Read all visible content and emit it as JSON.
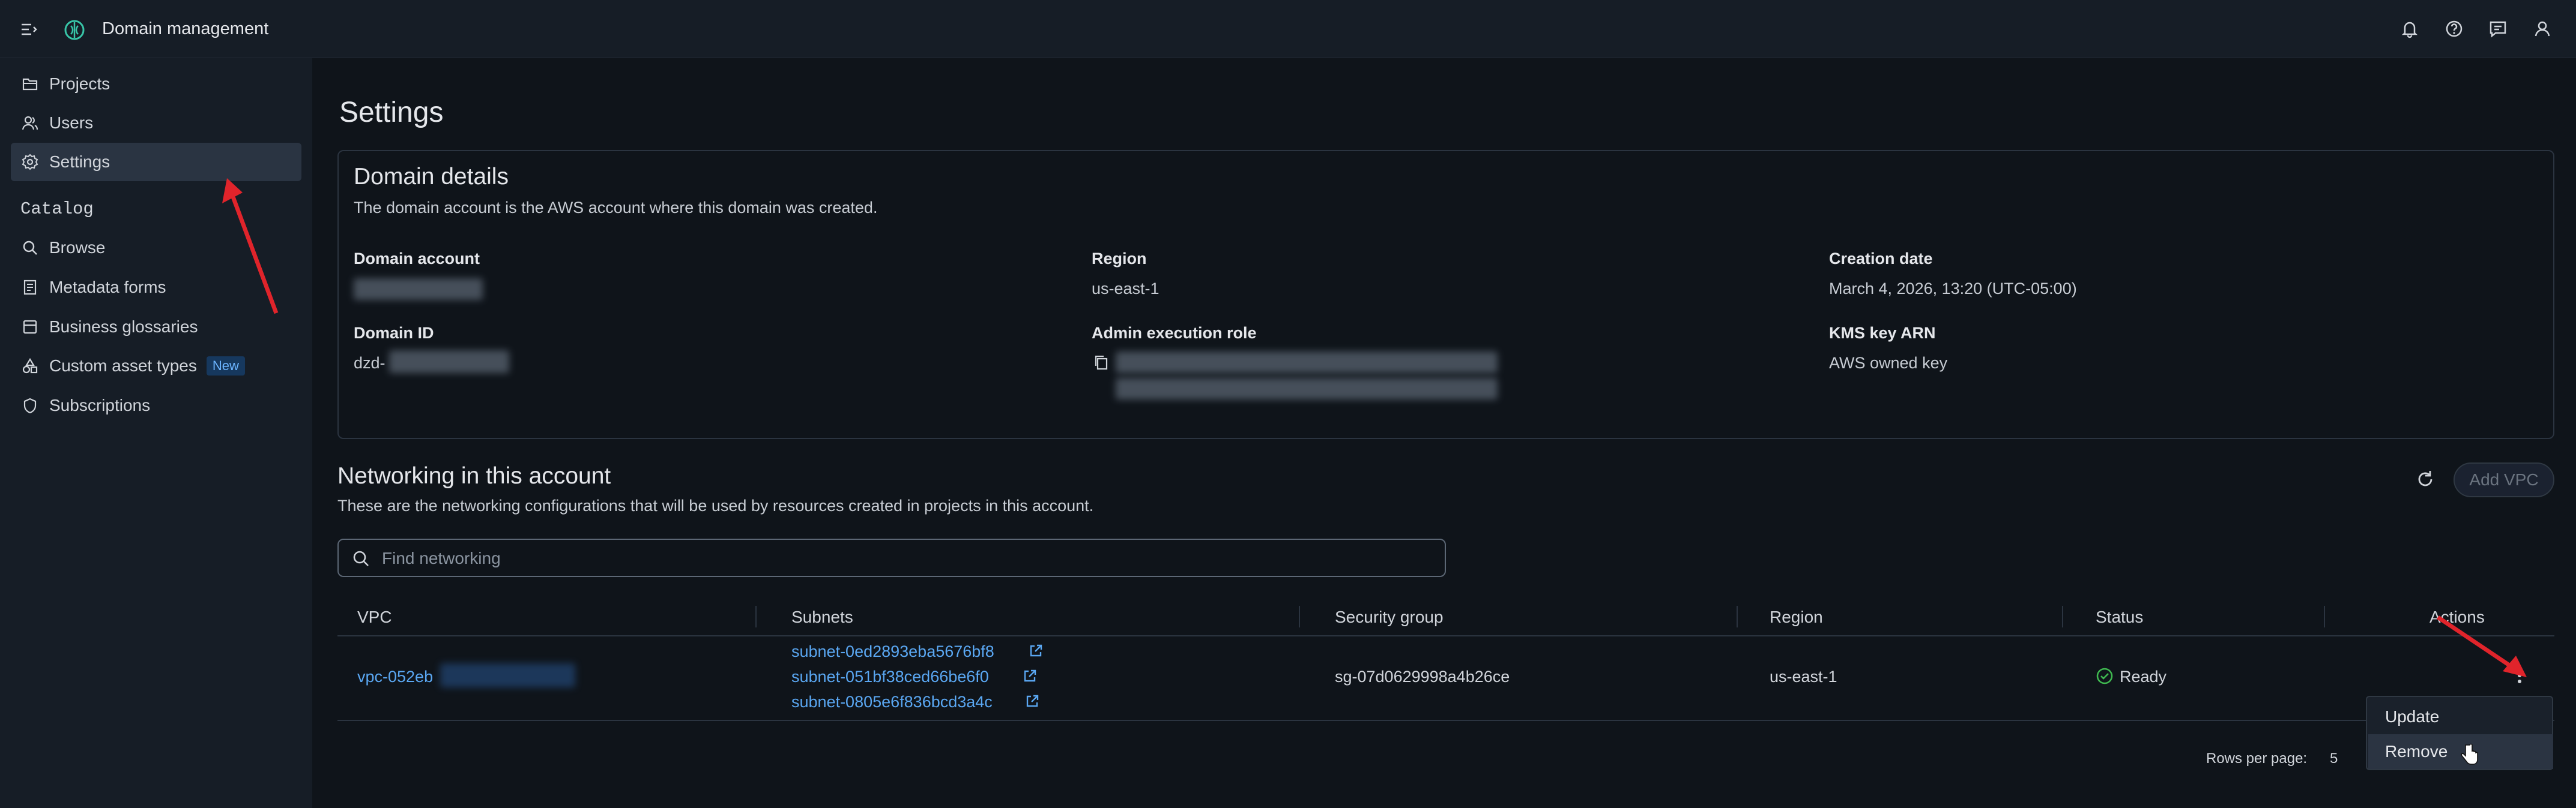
{
  "topbar": {
    "title": "Domain management"
  },
  "sidebar": {
    "items": [
      {
        "label": "Projects"
      },
      {
        "label": "Users"
      },
      {
        "label": "Settings"
      }
    ],
    "section_label": "Catalog",
    "catalog_items": [
      {
        "label": "Browse"
      },
      {
        "label": "Metadata forms"
      },
      {
        "label": "Business glossaries"
      },
      {
        "label": "Custom asset types",
        "badge": "New"
      },
      {
        "label": "Subscriptions"
      }
    ]
  },
  "page": {
    "title": "Settings"
  },
  "domain_details": {
    "heading": "Domain details",
    "description": "The domain account is the AWS account where this domain was created.",
    "fields": {
      "domain_account_label": "Domain account",
      "region_label": "Region",
      "region_value": "us-east-1",
      "creation_date_label": "Creation date",
      "creation_date_value": "March 4, 2026, 13:20 (UTC-05:00)",
      "domain_id_label": "Domain ID",
      "domain_id_prefix": "dzd-",
      "admin_role_label": "Admin execution role",
      "kms_label": "KMS key ARN",
      "kms_value": "AWS owned key"
    }
  },
  "networking": {
    "heading": "Networking in this account",
    "description": "These are the networking configurations that will be used by resources created in projects in this account.",
    "add_vpc_label": "Add VPC",
    "search_placeholder": "Find networking",
    "columns": [
      "VPC",
      "Subnets",
      "Security group",
      "Region",
      "Status",
      "Actions"
    ],
    "row": {
      "vpc_prefix": "vpc-052eb",
      "subnets": [
        "subnet-0ed2893eba5676bf8",
        "subnet-051bf38ced66be6f0",
        "subnet-0805e6f836bcd3a4c"
      ],
      "security_group": "sg-07d0629998a4b26ce",
      "region": "us-east-1",
      "status": "Ready"
    },
    "rows_per_page_label": "Rows per page:",
    "rows_per_page_value": "5",
    "actions_menu": [
      "Update",
      "Remove"
    ]
  },
  "colors": {
    "accent_link": "#5aa7f2",
    "ready_green": "#3fb950",
    "annotation_red": "#e0242b"
  }
}
